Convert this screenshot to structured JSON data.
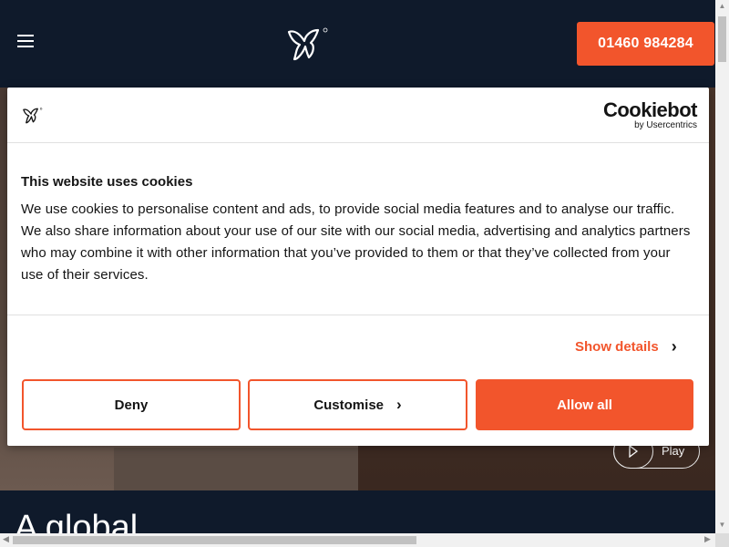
{
  "header": {
    "phone_label": "01460 984284"
  },
  "hero": {
    "play_label": "Play"
  },
  "section": {
    "title": "A global"
  },
  "cookie": {
    "brand_name": "Cookiebot",
    "brand_by": "by Usercentrics",
    "title": "This website uses cookies",
    "body": "We use cookies to personalise content and ads, to provide social media features and to analyse our traffic. We also share information about your use of our site with our social media, advertising and analytics partners who may combine it with other information that you’ve provided to them or that they’ve collected from your use of their services.",
    "show_details_label": "Show details",
    "deny_label": "Deny",
    "customise_label": "Customise",
    "allow_label": "Allow all"
  },
  "colors": {
    "accent": "#f2552c",
    "header_bg": "#0f1a2b",
    "text": "#141414"
  },
  "icons": [
    "hamburger-menu-icon",
    "butterfly-logo-icon",
    "play-icon",
    "chevron-right-icon"
  ]
}
